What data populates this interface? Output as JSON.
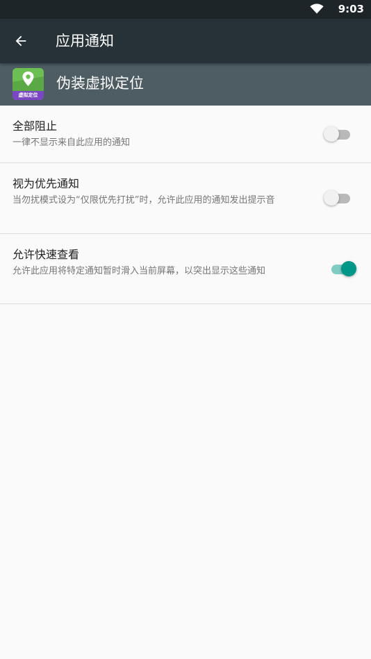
{
  "status_bar": {
    "time": "9:03",
    "icons": [
      "wifi-icon"
    ]
  },
  "toolbar": {
    "back_icon": "arrow-back-icon",
    "title": "应用通知"
  },
  "app_header": {
    "name": "伪装虚拟定位",
    "icon": "location-pin-app-icon",
    "icon_label": "虚拟定位"
  },
  "settings": [
    {
      "title": "全部阻止",
      "subtitle": "一律不显示来自此应用的通知",
      "enabled": false
    },
    {
      "title": "视为优先通知",
      "subtitle": "当勿扰模式设为“仅限优先打扰”时，允许此应用的通知发出提示音",
      "enabled": false
    },
    {
      "title": "允许快速查看",
      "subtitle": "允许此应用将特定通知暂时滑入当前屏幕，以突出显示这些通知",
      "enabled": true
    }
  ],
  "colors": {
    "toolbar": "#263238",
    "app_header": "#4e5d64",
    "accent": "#009688",
    "switch_track_on": "#80cbc4",
    "switch_track_off": "#b9b9b9",
    "background": "#fafafa"
  }
}
